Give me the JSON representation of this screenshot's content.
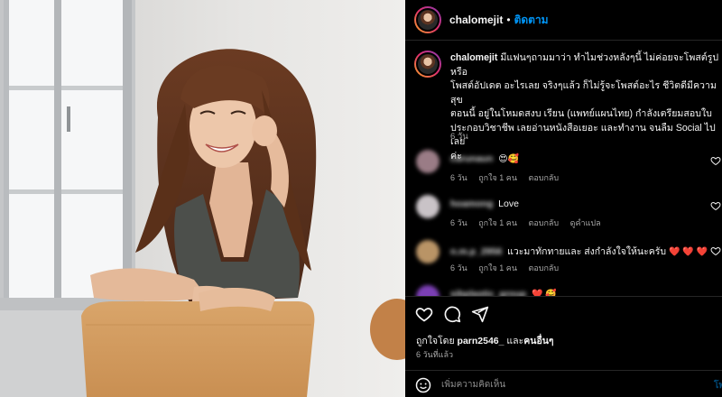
{
  "post": {
    "username": "chalomejit",
    "dot": "•",
    "follow_label": "ติดตาม",
    "caption_lines": [
      "มีแฟนๆถามมาว่า ทำไมช่วงหลังๆนี้ ไม่ค่อยจะโพสต์รูป หรือ",
      "โพสต์อัปเดต อะไรเลย จริงๆแล้ว ก็ไม่รู้จะโพสต์อะไร ชีวิตดีมีความสุข",
      "ตอนนี้ อยู่ในโหมดสงบ เรียน (แพทย์แผนไทย) กำลังเตรียมสอบใบ",
      "ประกอบวิชาชีพ เลยอ่านหนังสือเยอะ และทำงาน จนลืม Social ไปเลย",
      "ค่ะ"
    ],
    "caption_age": "6 วัน"
  },
  "comments": [
    {
      "username": "carunaun",
      "text": "",
      "emoji": "😍🥰",
      "age": "6 วัน",
      "likes": "ถูกใจ 1 คน",
      "reply": "ตอบกลับ",
      "translate": "",
      "avatar_color": "#9a7c86"
    },
    {
      "username": "hoamong",
      "text": "Love",
      "emoji": "",
      "age": "6 วัน",
      "likes": "ถูกใจ 1 คน",
      "reply": "ตอบกลับ",
      "translate": "ดูคำแปล",
      "avatar_color": "#c9c3c7"
    },
    {
      "username": "n.m.p_2956",
      "text": "แวะมาทักทายและ ส่งกำลังใจให้นะครับ",
      "emoji": "❤️ ❤️ ❤️",
      "age": "6 วัน",
      "likes": "ถูกใจ 1 คน",
      "reply": "ตอบกลับ",
      "translate": "",
      "avatar_color": "#b99466"
    },
    {
      "username": "sibplastic_group",
      "text": "",
      "emoji": "❤️ 🥰",
      "age": "",
      "likes": "",
      "reply": "",
      "translate": "",
      "avatar_color": "#7b3fb4"
    }
  ],
  "actions": {
    "like_icon": "heart-icon",
    "comment_icon": "comment-icon",
    "share_icon": "share-icon"
  },
  "likes_line": {
    "prefix": "ถูกใจโดย",
    "user": "parn2546_",
    "middle": "และ",
    "others": "คนอื่นๆ"
  },
  "posted_ago": "6 วันที่แล้ว",
  "composer": {
    "placeholder": "เพิ่มความคิดเห็น",
    "post_label": "โพ"
  },
  "colors": {
    "accent": "#0095f6",
    "background": "#000000",
    "muted": "#a8a8a8",
    "heart": "#ed4956"
  }
}
